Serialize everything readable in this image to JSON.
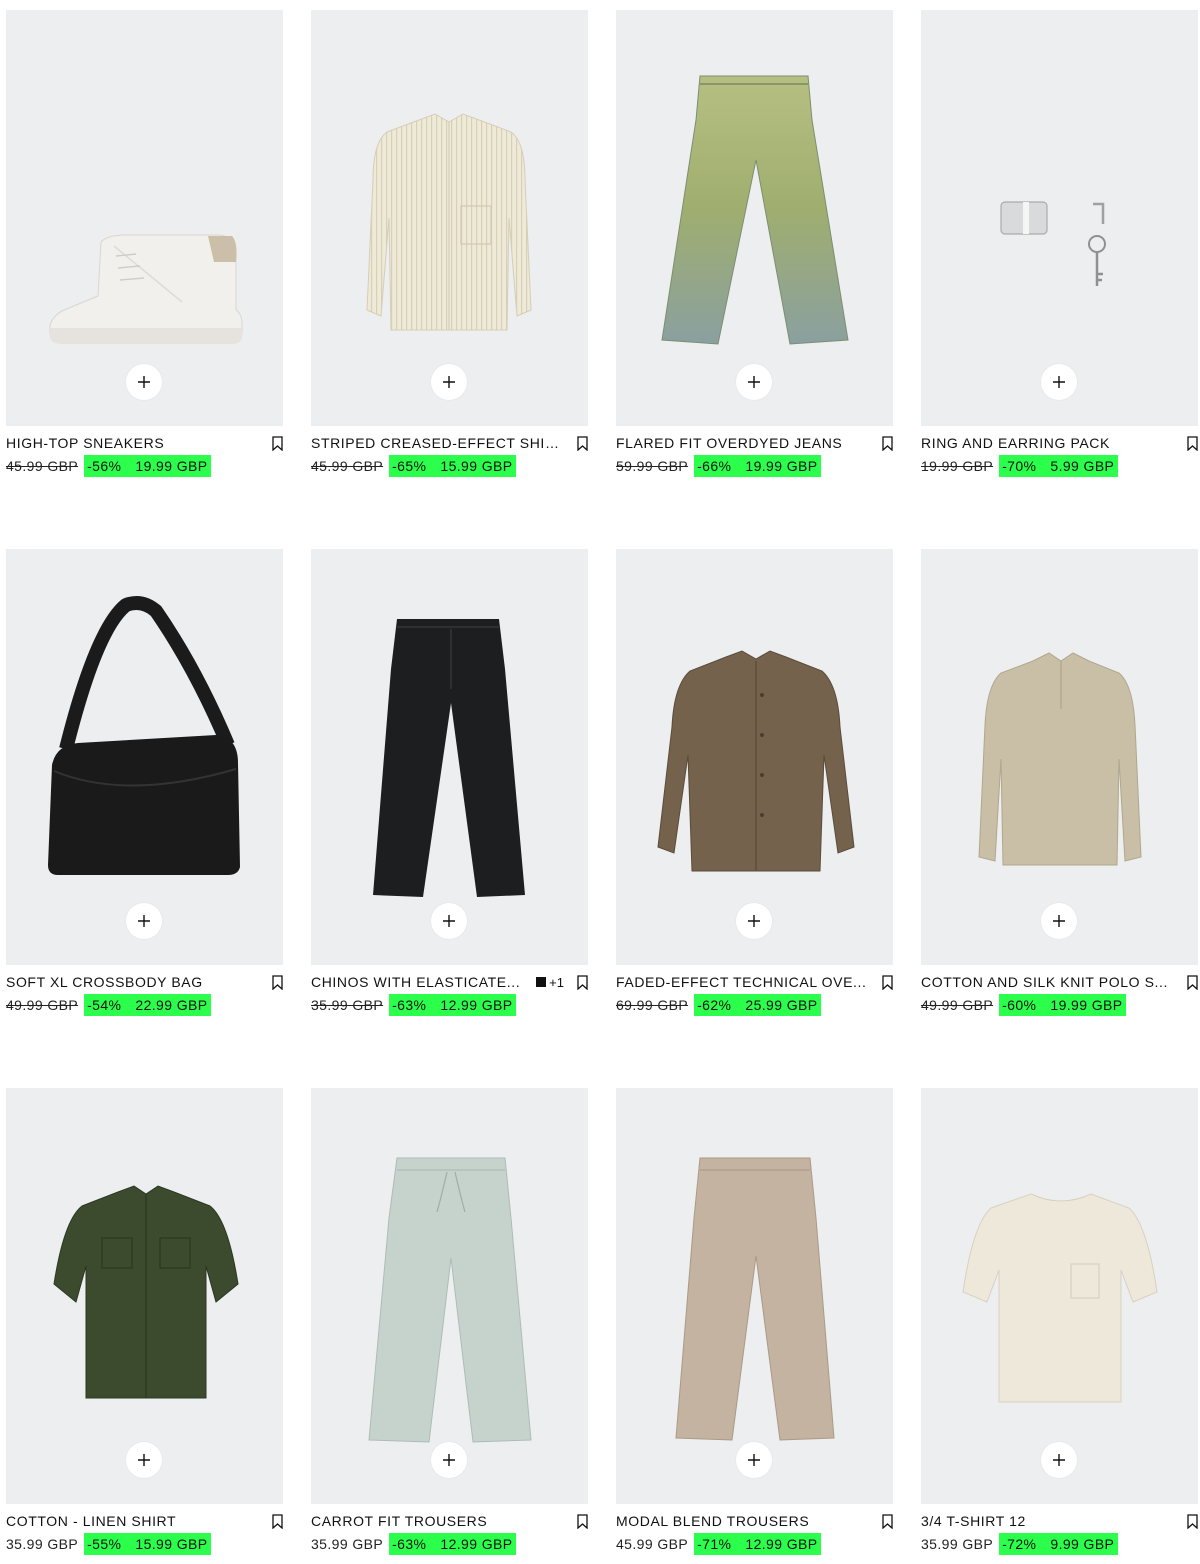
{
  "colors": {
    "card_background": "#eceef0",
    "sale_highlight": "#2bff4c",
    "text": "#111111"
  },
  "products": [
    {
      "title": "HIGH-TOP SNEAKERS",
      "old_price": "45.99 GBP",
      "old_struck": true,
      "discount": "-56%",
      "price": "19.99 GBP",
      "image": "sneaker-image",
      "colors_extra": null
    },
    {
      "title": "STRIPED CREASED-EFFECT SHIRT",
      "old_price": "45.99 GBP",
      "old_struck": true,
      "discount": "-65%",
      "price": "15.99 GBP",
      "image": "shirt-image",
      "colors_extra": null
    },
    {
      "title": "FLARED FIT OVERDYED JEANS",
      "old_price": "59.99 GBP",
      "old_struck": true,
      "discount": "-66%",
      "price": "19.99 GBP",
      "image": "jeans-image",
      "colors_extra": null
    },
    {
      "title": "RING AND EARRING PACK",
      "old_price": "19.99 GBP",
      "old_struck": true,
      "discount": "-70%",
      "price": "5.99 GBP",
      "image": "jewellery-image",
      "colors_extra": null
    },
    {
      "title": "SOFT XL CROSSBODY BAG",
      "old_price": "49.99 GBP",
      "old_struck": true,
      "discount": "-54%",
      "price": "22.99 GBP",
      "image": "bag-image",
      "colors_extra": null
    },
    {
      "title": "CHINOS WITH ELASTICATE...",
      "old_price": "35.99 GBP",
      "old_struck": true,
      "discount": "-63%",
      "price": "12.99 GBP",
      "image": "chinos-image",
      "colors_extra": "+1"
    },
    {
      "title": "FADED-EFFECT TECHNICAL OVE...",
      "old_price": "69.99 GBP",
      "old_struck": true,
      "discount": "-62%",
      "price": "25.99 GBP",
      "image": "overshirt-image",
      "colors_extra": null
    },
    {
      "title": "COTTON AND SILK KNIT POLO S...",
      "old_price": "49.99 GBP",
      "old_struck": true,
      "discount": "-60%",
      "price": "19.99 GBP",
      "image": "polo-image",
      "colors_extra": null
    },
    {
      "title": "COTTON - LINEN SHIRT",
      "old_price": "35.99 GBP",
      "old_struck": false,
      "discount": "-55%",
      "price": "15.99 GBP",
      "image": "linen-shirt-image",
      "colors_extra": null
    },
    {
      "title": "CARROT FIT TROUSERS",
      "old_price": "35.99 GBP",
      "old_struck": false,
      "discount": "-63%",
      "price": "12.99 GBP",
      "image": "carrot-trousers-image",
      "colors_extra": null
    },
    {
      "title": "MODAL BLEND TROUSERS",
      "old_price": "45.99 GBP",
      "old_struck": false,
      "discount": "-71%",
      "price": "12.99 GBP",
      "image": "modal-trousers-image",
      "colors_extra": null
    },
    {
      "title": "3/4 T-SHIRT 12",
      "old_price": "35.99 GBP",
      "old_struck": false,
      "discount": "-72%",
      "price": "9.99 GBP",
      "image": "tshirt-image",
      "colors_extra": null
    }
  ]
}
